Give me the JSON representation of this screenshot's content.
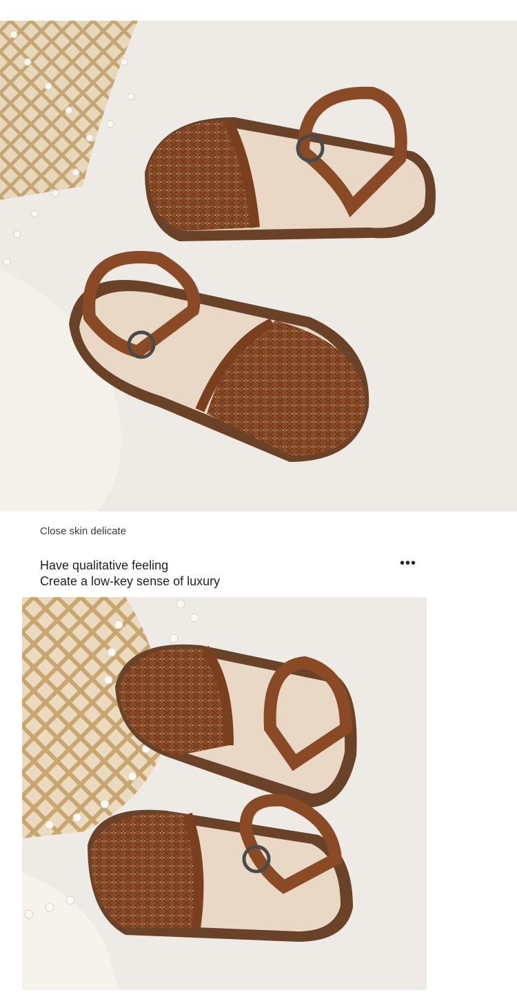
{
  "photos": [
    {
      "subject": "woven brown children's sandals on white fabric with pearls and rattan"
    },
    {
      "subject": "woven brown children's sandals close-up beside rattan bag and pearls"
    }
  ],
  "text": {
    "subtitle": "Close skin delicate",
    "headline_line1": "Have qualitative feeling",
    "headline_line2": "Create a low-key sense of luxury",
    "more_glyph": "•••"
  },
  "colors": {
    "leather": "#8a4a26",
    "leather_dark": "#5e3018",
    "insole": "#ead8c6",
    "fabric": "#eeebe7",
    "rattan": "#d8c09a"
  }
}
